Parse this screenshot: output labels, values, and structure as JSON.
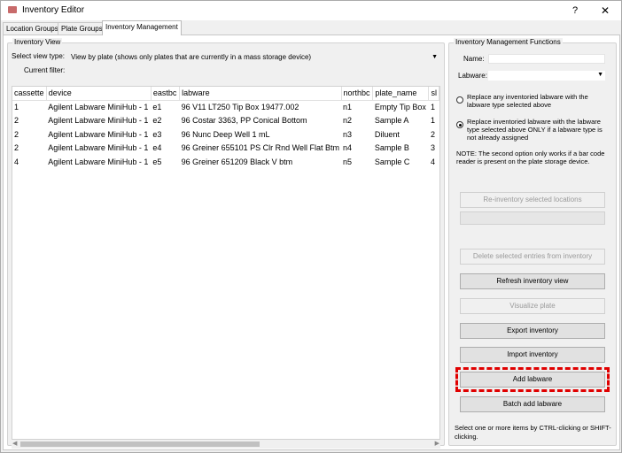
{
  "window": {
    "title": "Inventory Editor",
    "help_symbol": "?",
    "close_symbol": "✕"
  },
  "tabs": [
    {
      "label": "Location Groups",
      "active": false
    },
    {
      "label": "Plate Groups",
      "active": false
    },
    {
      "label": "Inventory Management",
      "active": true
    }
  ],
  "inventory_view": {
    "group_title": "Inventory View",
    "view_type_label": "Select view type:",
    "view_type_value": "View by plate (shows only plates that are currently in a mass storage device)",
    "current_filter_label": "Current filter:",
    "columns": [
      "cassette",
      "device",
      "eastbc",
      "labware",
      "northbc",
      "plate_name",
      "sl"
    ],
    "rows": [
      [
        "1",
        "Agilent Labware MiniHub - 1",
        "e1",
        "96 V11 LT250 Tip Box 19477.002",
        "n1",
        "Empty Tip Box",
        "1"
      ],
      [
        "2",
        "Agilent Labware MiniHub - 1",
        "e2",
        "96 Costar 3363, PP Conical Bottom",
        "n2",
        "Sample A",
        "1"
      ],
      [
        "2",
        "Agilent Labware MiniHub - 1",
        "e3",
        "96 Nunc Deep Well 1 mL",
        "n3",
        "Diluent",
        "2"
      ],
      [
        "2",
        "Agilent Labware MiniHub - 1",
        "e4",
        "96 Greiner 655101 PS Clr Rnd Well Flat Btm",
        "n4",
        "Sample B",
        "3"
      ],
      [
        "4",
        "Agilent Labware MiniHub - 1",
        "e5",
        "96 Greiner 651209 Black V btm",
        "n5",
        "Sample C",
        "4"
      ]
    ]
  },
  "functions": {
    "group_title": "Inventory Management Functions",
    "name_label": "Name:",
    "name_value": "",
    "labware_label": "Labware:",
    "labware_value": "",
    "radio_replace_any": "Replace any inventoried labware with the labware type selected above",
    "radio_replace_only": "Replace inventoried labware with the labware type selected above ONLY if a labware type is not already assigned",
    "note": "NOTE: The second option only works if a bar code reader is present on the plate storage device.",
    "buttons": {
      "reinventory": "Re-inventory selected locations",
      "delete": "Delete selected entries from inventory",
      "refresh": "Refresh inventory view",
      "visualize": "Visualize plate",
      "export": "Export inventory",
      "import": "Import inventory",
      "add": "Add labware",
      "batch_add": "Batch add labware"
    },
    "hint": "Select one or more items by CTRL-clicking or SHIFT-clicking."
  },
  "colors": {
    "highlight": "#e00000"
  }
}
